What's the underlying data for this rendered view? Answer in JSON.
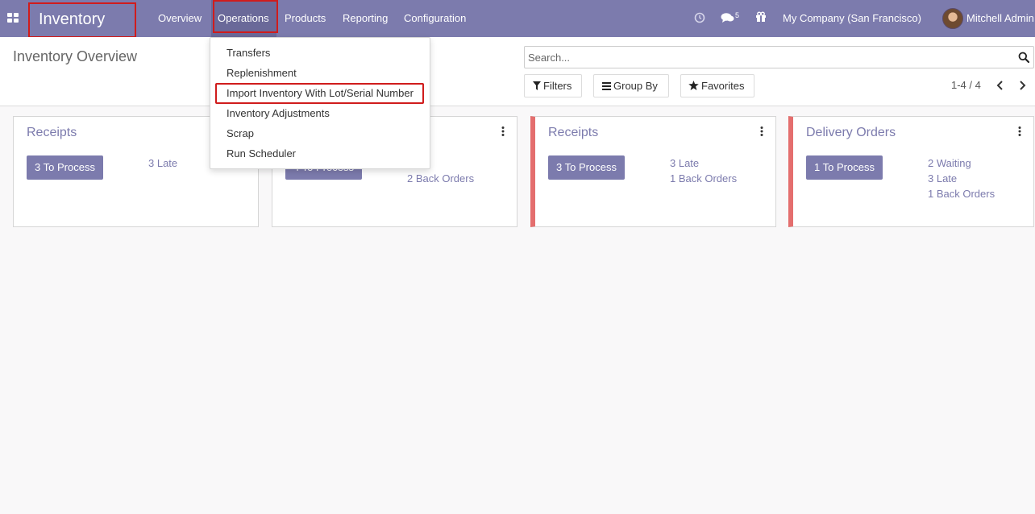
{
  "navbar": {
    "brand": "Inventory",
    "menu": [
      "Overview",
      "Operations",
      "Products",
      "Reporting",
      "Configuration"
    ],
    "message_count": "5",
    "company": "My Company (San Francisco)",
    "user": "Mitchell Admin"
  },
  "operations_menu": {
    "items": [
      "Transfers",
      "Replenishment",
      "Import Inventory With Lot/Serial Number",
      "Inventory Adjustments",
      "Scrap",
      "Run Scheduler"
    ]
  },
  "control_panel": {
    "title": "Inventory Overview",
    "search_placeholder": "Search...",
    "filters_label": "Filters",
    "group_by_label": "Group By",
    "favorites_label": "Favorites",
    "pager": "1-4 / 4"
  },
  "cards": [
    {
      "title": "Receipts",
      "button": "3 To Process",
      "links": [
        "3 Late"
      ]
    },
    {
      "title": "",
      "button": "4 To Process",
      "links": [
        "e",
        "2 Back Orders"
      ]
    },
    {
      "title": "Receipts",
      "button": "3 To Process",
      "links": [
        "3 Late",
        "1 Back Orders"
      ]
    },
    {
      "title": "Delivery Orders",
      "button": "1 To Process",
      "links": [
        "2 Waiting",
        "3 Late",
        "1 Back Orders"
      ]
    }
  ],
  "colors": {
    "primary": "#7c7bad",
    "highlight_border": "#d01c1c",
    "card_accent": "#e46e6e"
  }
}
